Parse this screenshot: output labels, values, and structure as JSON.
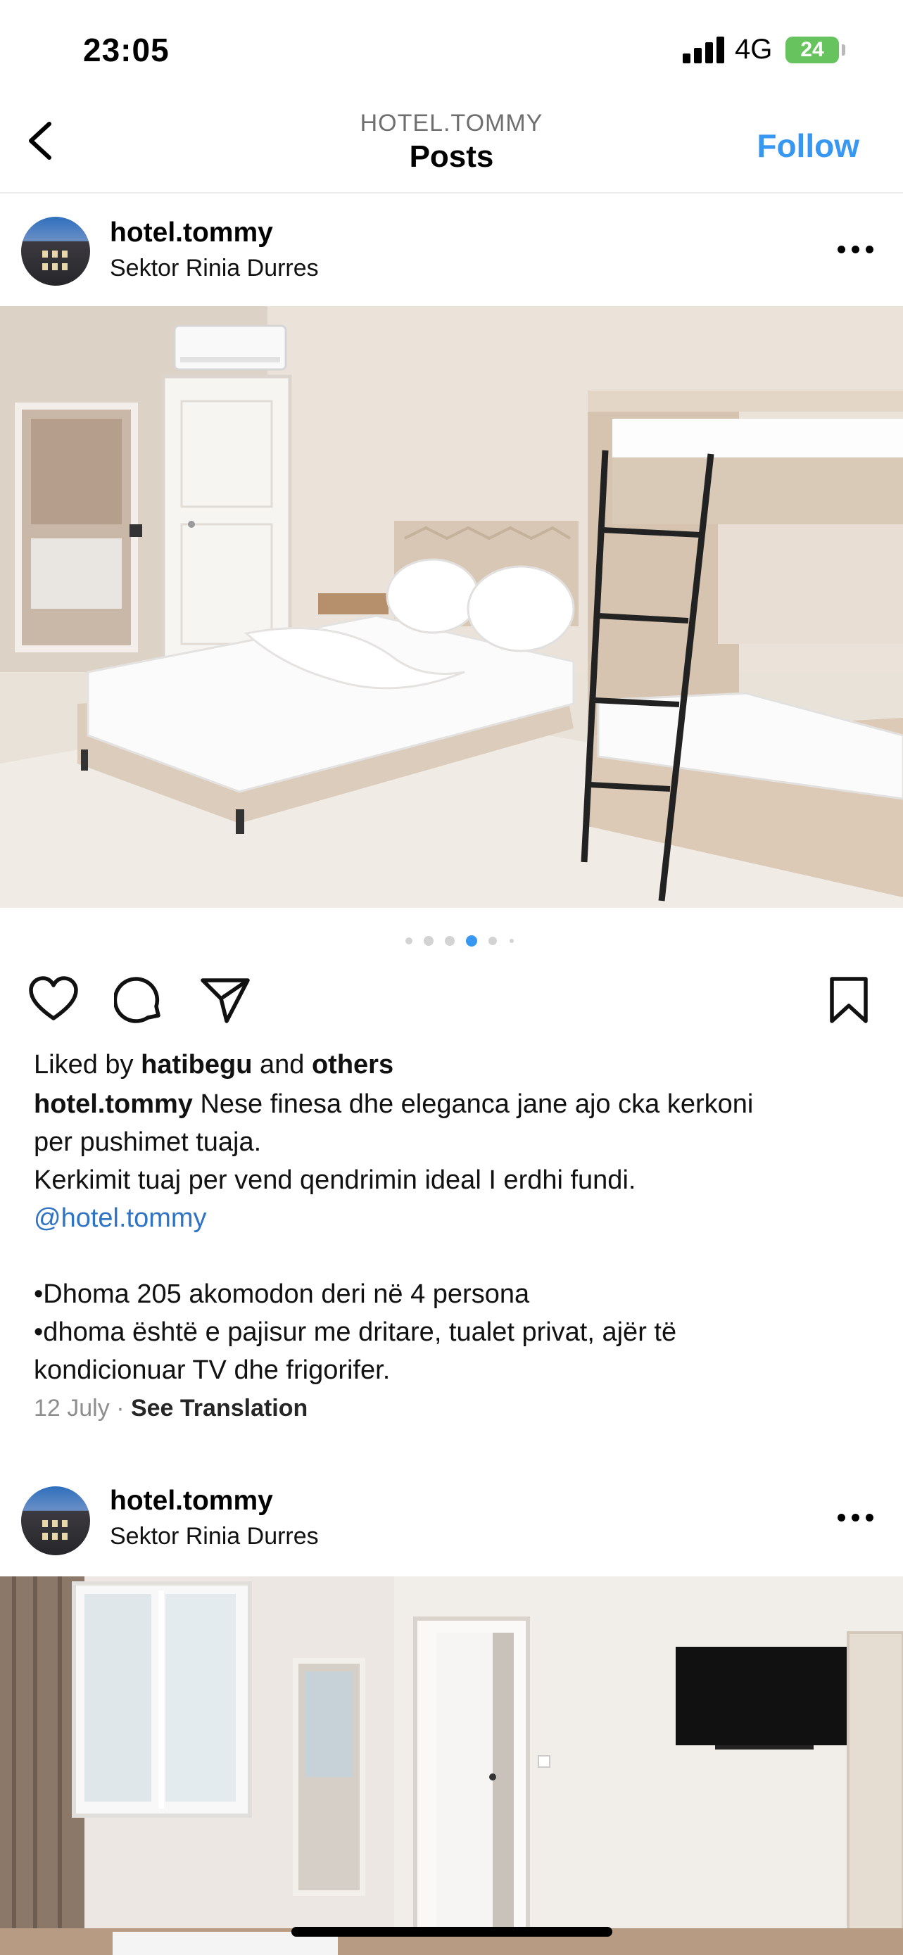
{
  "status": {
    "time": "23:05",
    "network": "4G",
    "battery": "24"
  },
  "nav": {
    "account": "HOTEL.TOMMY",
    "title": "Posts",
    "follow_label": "Follow"
  },
  "posts": [
    {
      "username": "hotel.tommy",
      "location": "Sektor Rinia Durres",
      "carousel": {
        "count": 6,
        "active_index": 3
      },
      "liked_prefix": "Liked by",
      "liked_user": "hatibegu",
      "liked_and": "and",
      "liked_others": "others",
      "caption_user": "hotel.tommy",
      "caption_line1": "Nese finesa dhe eleganca jane ajo cka kerkoni",
      "caption_line2": "per pushimet tuaja.",
      "caption_line3": "Kerkimit tuaj per vend qendrimin ideal I erdhi fundi.",
      "caption_mention": "@hotel.tommy",
      "bullet1": "•Dhoma 205 akomodon deri në 4 persona",
      "bullet2_line1": "•dhoma është e pajisur me dritare, tualet privat, ajër të",
      "bullet2_line2": "kondicionuar TV  dhe frigorifer.",
      "date": "12 July",
      "separator": "·",
      "see_translation": "See Translation"
    },
    {
      "username": "hotel.tommy",
      "location": "Sektor Rinia Durres"
    }
  ],
  "colors": {
    "accent": "#3897f0",
    "mention": "#2f73c4",
    "battery": "#67c35d",
    "active_dot": "#3897f0"
  }
}
